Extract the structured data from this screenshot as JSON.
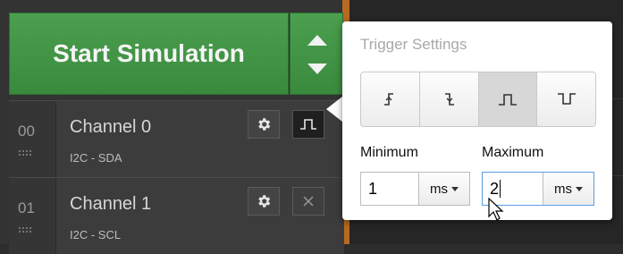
{
  "toolbar": {
    "start_label": "Start Simulation"
  },
  "channels": [
    {
      "number": "00",
      "name": "Channel 0",
      "protocol": "I2C - SDA"
    },
    {
      "number": "01",
      "name": "Channel 1",
      "protocol": "I2C - SCL"
    }
  ],
  "trigger_popup": {
    "title": "Trigger Settings",
    "modes": [
      {
        "icon": "rising-edge-icon"
      },
      {
        "icon": "falling-edge-icon"
      },
      {
        "icon": "positive-pulse-icon",
        "active": true
      },
      {
        "icon": "negative-pulse-icon"
      }
    ],
    "minimum_label": "Minimum",
    "maximum_label": "Maximum",
    "minimum_value": "1",
    "maximum_value": "2",
    "minimum_unit": "ms",
    "maximum_unit": "ms"
  },
  "colors": {
    "start_green": "#4b9f4e",
    "accent_orange": "#b96a22",
    "focus_blue": "#5b9de0"
  }
}
